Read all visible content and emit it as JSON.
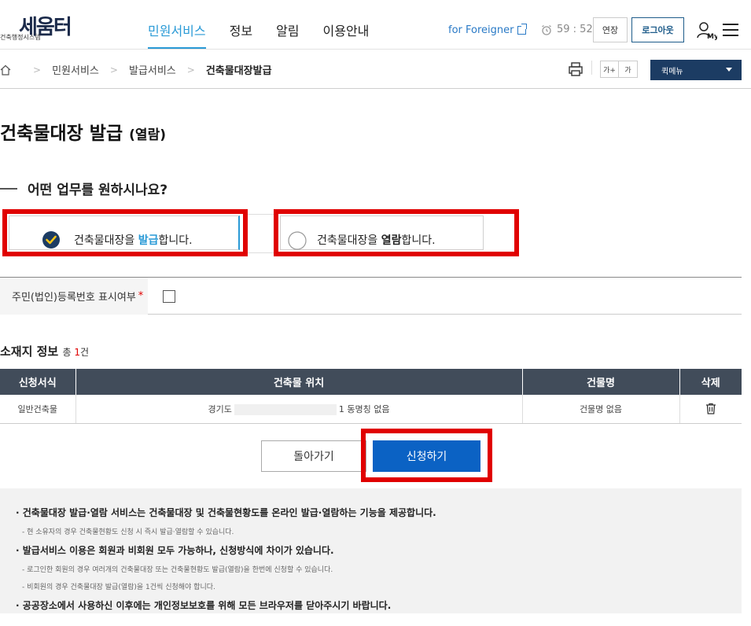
{
  "header": {
    "logo_main": "세움터",
    "logo_sub": "건축행정시스템",
    "nav": [
      "민원서비스",
      "정보",
      "알림",
      "이용안내"
    ],
    "foreigner": "for Foreigner",
    "timer": "59 : 52",
    "extend_label": "연장",
    "logout_label": "로그아웃",
    "my_label": "My"
  },
  "breadcrumb": {
    "items": [
      "민원서비스",
      "발급서비스"
    ],
    "current": "건축물대장발급"
  },
  "tools": {
    "font_plus": "가+",
    "font_minus": "가",
    "quick_menu": "퀵메뉴"
  },
  "page": {
    "title": "건축물대장 발급",
    "title_suffix": "(열람)",
    "question": "어떤 업무를 원하시나요?"
  },
  "options": [
    {
      "prefix": "건축물대장을 ",
      "highlight": "발급",
      "suffix": "합니다.",
      "selected": true
    },
    {
      "prefix": "건축물대장을 ",
      "highlight": "열람",
      "suffix": "합니다.",
      "selected": false
    }
  ],
  "resident": {
    "label": "주민(법인)등록번호 표시여부",
    "required_mark": "*"
  },
  "location": {
    "title": "소재지 정보",
    "count_prefix": "총 ",
    "count": "1",
    "count_suffix": "건"
  },
  "table": {
    "headers": [
      "신청서식",
      "건축물 위치",
      "건물명",
      "삭제"
    ],
    "rows": [
      {
        "form": "일반건축물",
        "loc_prefix": "경기도",
        "loc_suffix": "1 동명칭 없음",
        "building": "건물명 없음"
      }
    ]
  },
  "buttons": {
    "back": "돌아가기",
    "apply": "신청하기"
  },
  "notice": [
    {
      "type": "main",
      "text": "· 건축물대장 발급·열람 서비스는 건축물대장 및 건축물현황도를 온라인 발급·열람하는 기능을 제공합니다."
    },
    {
      "type": "sub",
      "text": "- 현 소유자의 경우 건축물현황도 신청 시 즉시 발급·열람할 수 있습니다."
    },
    {
      "type": "main",
      "text": "· 발급서비스 이용은 회원과 비회원 모두 가능하나, 신청방식에 차이가 있습니다."
    },
    {
      "type": "sub",
      "text": "- 로그인한 회원의 경우 여러개의 건축물대장 또는 건축물현황도 발급(열람)을 한번에 신청할 수 있습니다."
    },
    {
      "type": "sub",
      "text": "- 비회원의 경우 건축물대장 발급(열람)을 1건씩 신청해야 합니다."
    },
    {
      "type": "main",
      "text": "· 공공장소에서 사용하신 이후에는 개인정보보호를 위해 모든 브라우저를 닫아주시기 바랍니다."
    }
  ],
  "colors": {
    "accent": "#2a9ad6",
    "highlight_box": "#e00000",
    "apply_button": "#0b62c4",
    "table_header": "#414c5a",
    "quick_menu": "#1c3c63"
  }
}
